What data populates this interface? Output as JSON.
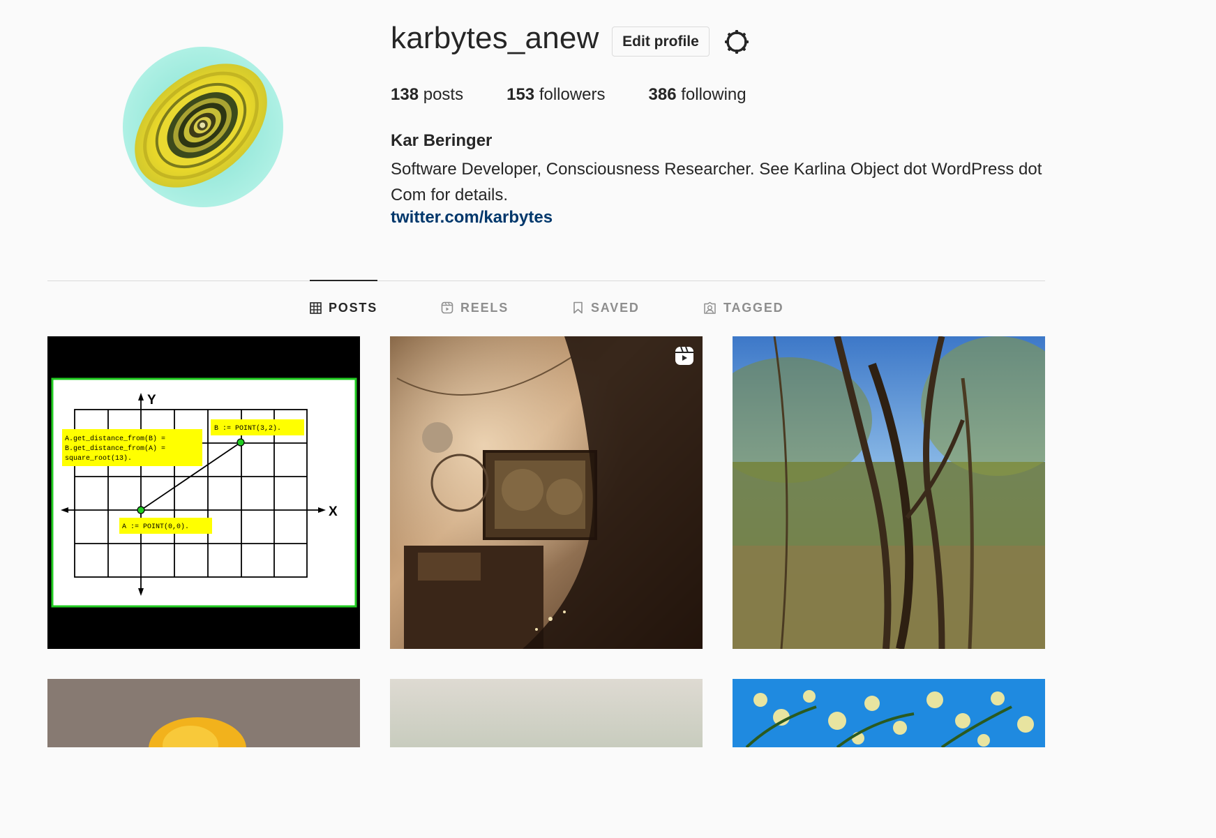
{
  "profile": {
    "username": "karbytes_anew",
    "edit_label": "Edit profile",
    "settings_icon": "gear-icon",
    "stats": {
      "posts_count": "138",
      "posts_label": "posts",
      "followers_count": "153",
      "followers_label": "followers",
      "following_count": "386",
      "following_label": "following"
    },
    "full_name": "Kar Beringer",
    "bio": "Software Developer, Consciousness Researcher. See Karlina Object dot WordPress dot Com for details.",
    "link": "twitter.com/karbytes"
  },
  "tabs": [
    {
      "label": "POSTS",
      "icon": "grid-icon",
      "active": true
    },
    {
      "label": "REELS",
      "icon": "reels-icon",
      "active": false
    },
    {
      "label": "SAVED",
      "icon": "bookmark-icon",
      "active": false
    },
    {
      "label": "TAGGED",
      "icon": "tagged-icon",
      "active": false
    }
  ],
  "posts": {
    "post1": {
      "y_axis": "Y",
      "x_axis": "X",
      "b_label": "B := POINT(3,2).",
      "a_label": "A := POINT(0,0).",
      "distance_line1": "A.get_distance_from(B) =",
      "distance_line2": "B.get_distance_from(A) =",
      "distance_line3": "square_root(13)."
    }
  },
  "colors": {
    "link": "#00376b",
    "highlight": "#ffff00",
    "point_green": "#22cc22",
    "border_green": "#22cc22"
  }
}
